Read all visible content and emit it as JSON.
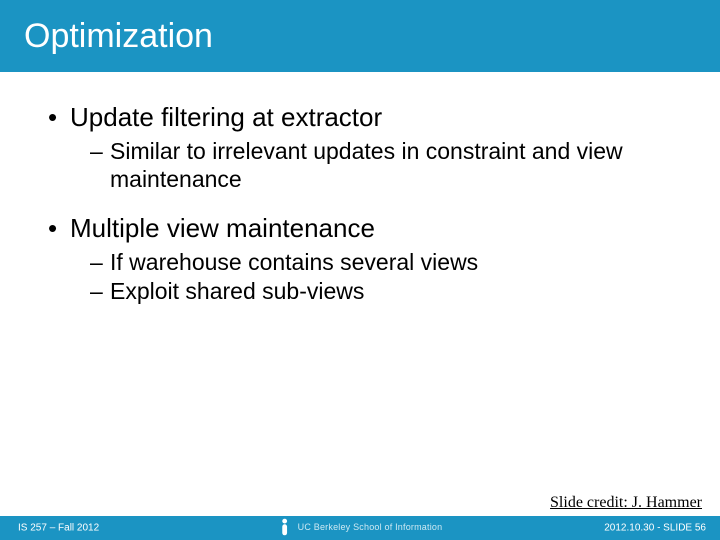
{
  "title": "Optimization",
  "bullets": [
    {
      "text": "Update filtering at extractor",
      "sub": [
        "Similar to irrelevant updates in constraint and view maintenance"
      ]
    },
    {
      "text": "Multiple view maintenance",
      "sub": [
        "If warehouse contains several views",
        "Exploit shared sub-views"
      ]
    }
  ],
  "credit": "Slide credit: J. Hammer",
  "footer": {
    "left": "IS 257 – Fall 2012",
    "logo_text": "UC Berkeley School of Information",
    "right": "2012.10.30 - SLIDE 56"
  },
  "colors": {
    "band": "#1b94c3"
  }
}
